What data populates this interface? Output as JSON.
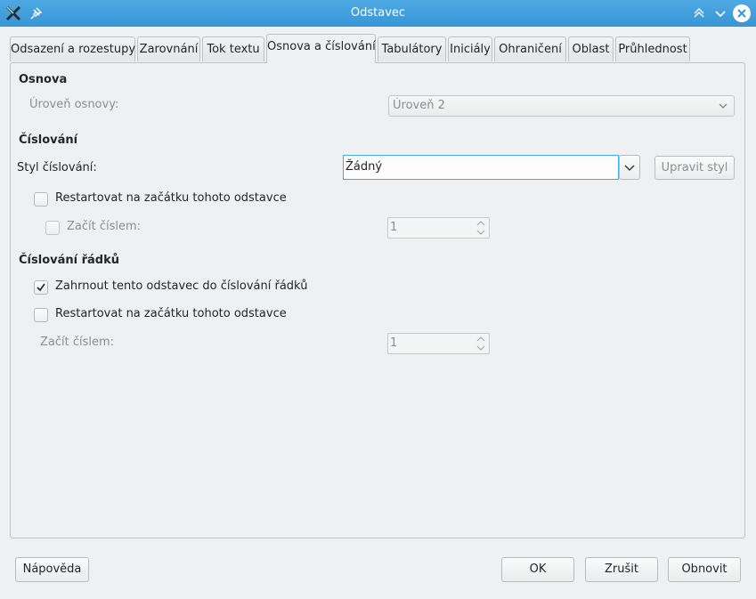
{
  "window": {
    "title": "Odstavec",
    "icons": [
      "app-icon",
      "pin-icon",
      "minimize-icon",
      "maximize-icon",
      "close-icon"
    ]
  },
  "tabs": [
    {
      "label": "Odsazení a rozestupy"
    },
    {
      "label": "Zarovnání"
    },
    {
      "label": "Tok textu"
    },
    {
      "label": "Osnova a číslování"
    },
    {
      "label": "Tabulátory"
    },
    {
      "label": "Iniciály"
    },
    {
      "label": "Ohraničení"
    },
    {
      "label": "Oblast"
    },
    {
      "label": "Průhlednost"
    }
  ],
  "active_tab": "Osnova a číslování",
  "outline": {
    "heading": "Osnova",
    "level_label": "Úroveň osnovy:",
    "level_value": "Úroveň 2"
  },
  "numbering": {
    "heading": "Číslování",
    "style_label": "Styl číslování:",
    "style_value": "Žádný",
    "edit_style_label": "Upravit styl",
    "restart_label": "Restartovat na začátku tohoto odstavce",
    "start_label": "Začít číslem:",
    "start_value": "1"
  },
  "line_numbering": {
    "heading": "Číslování řádků",
    "include_label": "Zahrnout tento odstavec do číslování řádků",
    "include_checked": true,
    "restart_label": "Restartovat na začátku tohoto odstavce",
    "start_label": "Začít číslem:",
    "start_value": "1"
  },
  "footer": {
    "help_label": "Nápověda",
    "ok_label": "OK",
    "cancel_label": "Zrušit",
    "reset_label": "Obnovit"
  },
  "colors": {
    "titlebar": "#3da6e6",
    "focus": "#3daee9"
  }
}
